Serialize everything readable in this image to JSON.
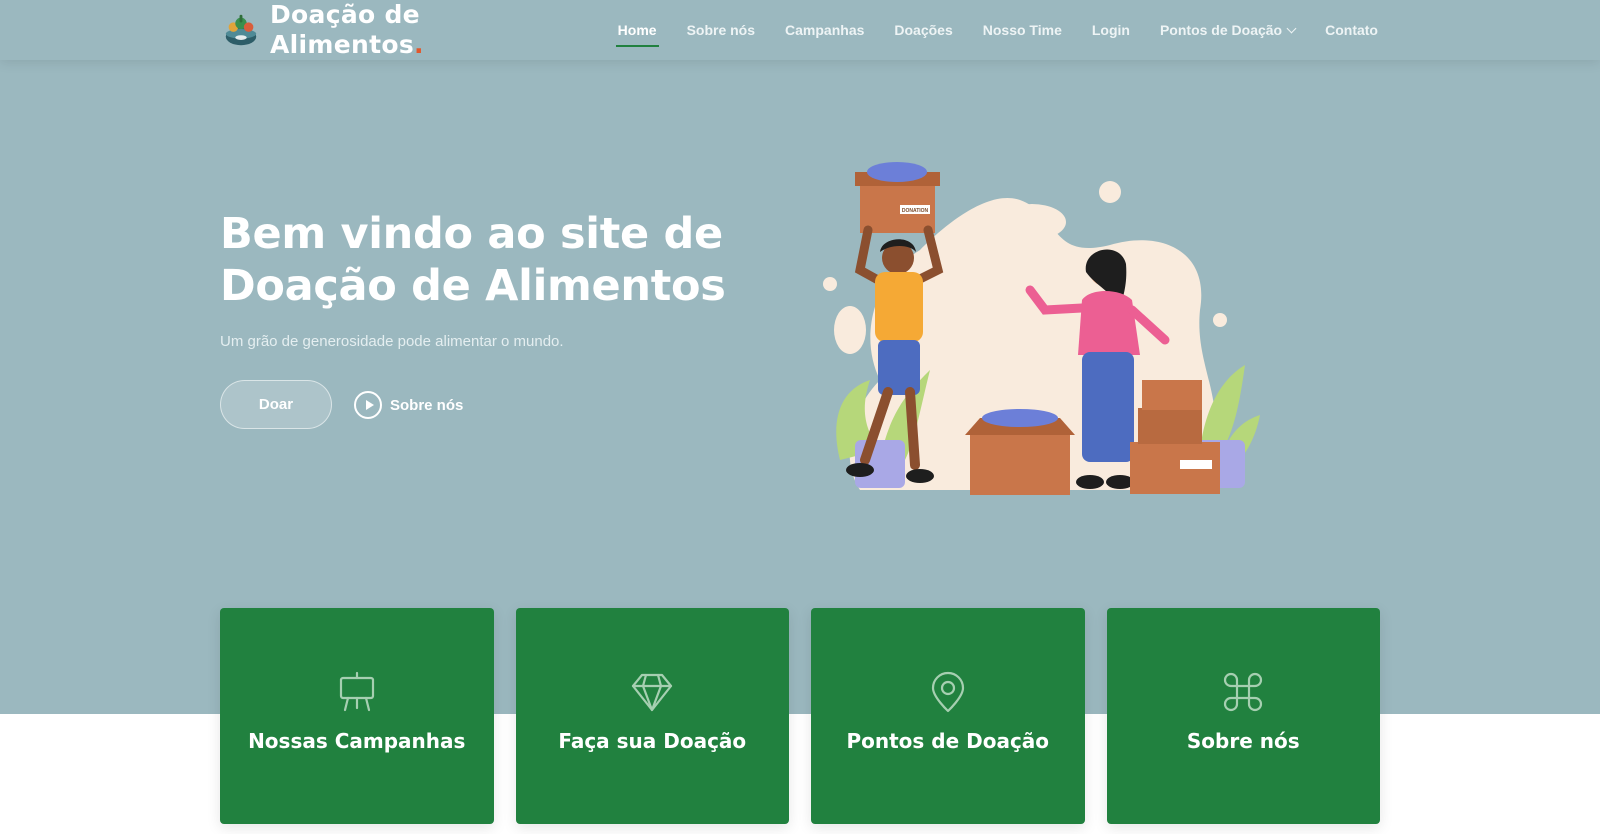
{
  "brand": {
    "line1": "Doação de",
    "line2": "Alimentos",
    "dot": ".",
    "dot_color": "#e2572b"
  },
  "nav": [
    {
      "label": "Home",
      "active": true
    },
    {
      "label": "Sobre nós"
    },
    {
      "label": "Campanhas"
    },
    {
      "label": "Doações"
    },
    {
      "label": "Nosso Time"
    },
    {
      "label": "Login"
    },
    {
      "label": "Pontos de Doação",
      "dropdown": true
    },
    {
      "label": "Contato"
    }
  ],
  "hero": {
    "title_line1": "Bem vindo ao site de",
    "title_line2": "Doação de Alimentos",
    "subtitle": "Um grão de generosidade pode alimentar o mundo.",
    "primary_button": "Doar",
    "secondary_button": "Sobre nós",
    "box_label": "DONATION"
  },
  "cards": [
    {
      "title": "Nossas Campanhas",
      "icon": "easel-icon"
    },
    {
      "title": "Faça sua Doação",
      "icon": "diamond-icon"
    },
    {
      "title": "Pontos de Doação",
      "icon": "map-pin-icon"
    },
    {
      "title": "Sobre nós",
      "icon": "command-icon"
    }
  ],
  "colors": {
    "hero_bg": "#9bb8bf",
    "card_green": "#21813f",
    "accent": "#e2572b"
  }
}
